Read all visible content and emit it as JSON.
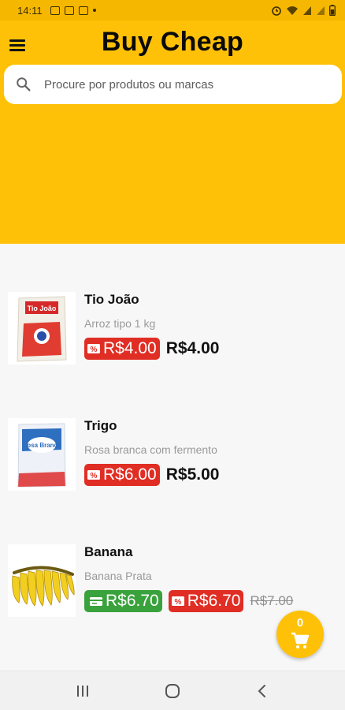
{
  "status_bar": {
    "time": "14:11"
  },
  "header": {
    "title": "Buy Cheap",
    "search_placeholder": "Procure por produtos ou marcas"
  },
  "products": [
    {
      "name": "Tio João",
      "description": "Arroz tipo 1 kg",
      "discount_price": "R$4.00",
      "final_price": "R$4.00",
      "image_icon": "rice-bag-icon"
    },
    {
      "name": "Trigo",
      "description": "Rosa branca com fermento",
      "discount_price": "R$6.00",
      "final_price": "R$5.00",
      "image_icon": "flour-bag-icon"
    },
    {
      "name": "Banana",
      "description": "Banana Prata",
      "card_price": "R$6.70",
      "discount_price": "R$6.70",
      "old_price": "R$7.00",
      "image_icon": "banana-icon"
    }
  ],
  "cart": {
    "count": "0"
  },
  "colors": {
    "accent": "#ffc107",
    "discount_red": "#e02e24",
    "card_green": "#3aa23c"
  }
}
